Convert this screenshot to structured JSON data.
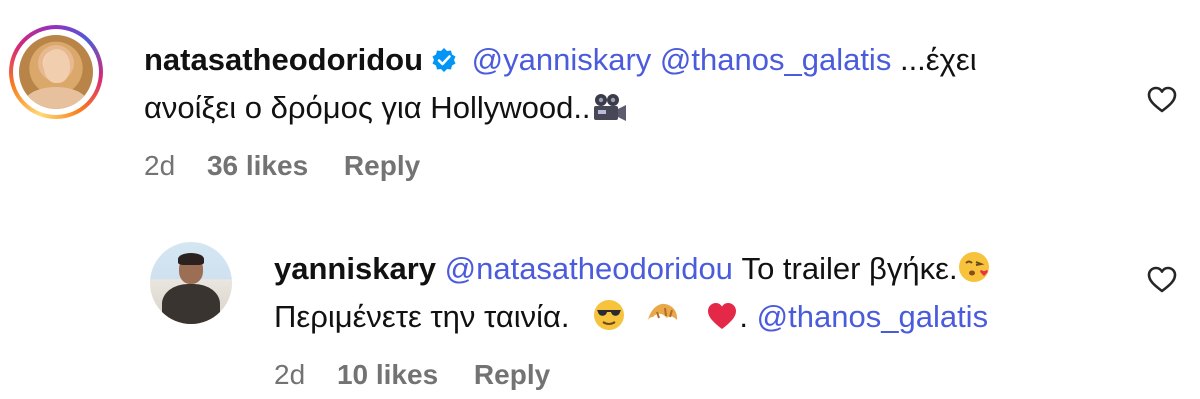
{
  "comment": {
    "username": "natasatheodoridou",
    "verified": true,
    "mention_1": "@yanniskary",
    "mention_2": "@thanos_galatis",
    "text_line1_tail": "...έχει",
    "text_line2": "ανοίξει ο δρόμος για Hollywood..",
    "emoji": "movie-camera-icon",
    "time": "2d",
    "likes": "36 likes",
    "reply_label": "Reply"
  },
  "reply": {
    "username": "yanniskary",
    "mention_1": "@natasatheodoridou",
    "text_line1": "Το trailer βγήκε.",
    "emoji_1": "face-blowing-kiss-icon",
    "text_line2": "Περιμένετε την ταινία.",
    "emoji_2": "sunglasses-face-icon",
    "emoji_3": "croissant-icon",
    "emoji_4": "red-heart-icon",
    "text_line2_sep": ".",
    "mention_2": "@thanos_galatis",
    "time": "2d",
    "likes": "10 likes",
    "reply_label": "Reply"
  },
  "colors": {
    "mention": "#4a5bdb",
    "meta": "#737373",
    "verified": "#0095f6"
  }
}
